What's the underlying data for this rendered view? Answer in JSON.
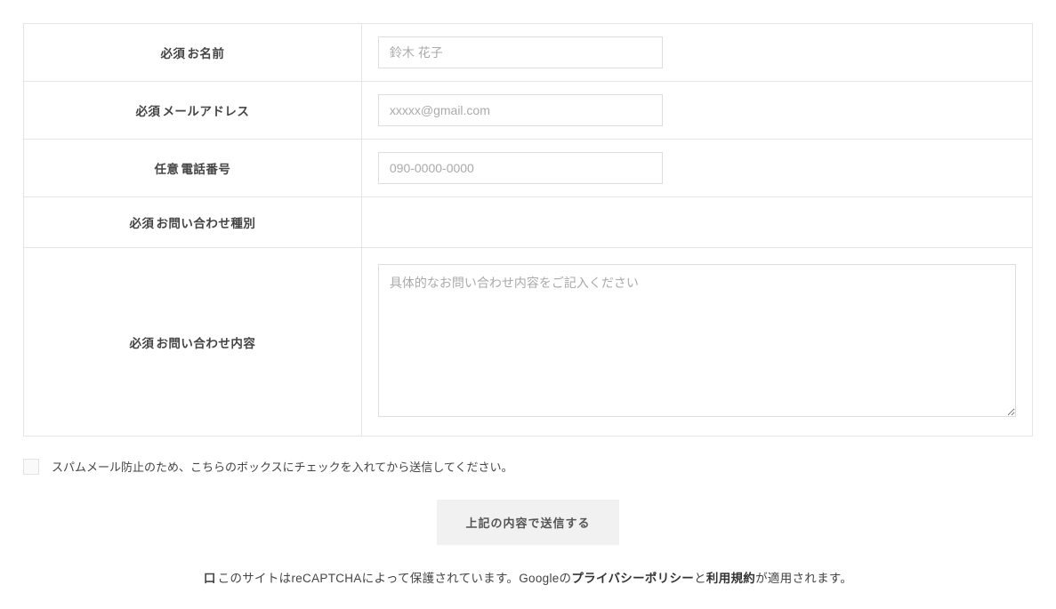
{
  "form": {
    "rows": [
      {
        "badge": "必須",
        "label": "お名前",
        "placeholder": "鈴木 花子"
      },
      {
        "badge": "必須",
        "label": "メールアドレス",
        "placeholder": "xxxxx@gmail.com"
      },
      {
        "badge": "任意",
        "label": "電話番号",
        "placeholder": "090-0000-0000"
      },
      {
        "badge": "必須",
        "label": "お問い合わせ種別"
      },
      {
        "badge": "必須",
        "label": "お問い合わせ内容",
        "placeholder": "具体的なお問い合わせ内容をご記入ください"
      }
    ]
  },
  "spam": {
    "label": "スパムメール防止のため、こちらのボックスにチェックを入れてから送信してください。"
  },
  "submit": {
    "label": "上記の内容で送信する"
  },
  "recaptcha": {
    "prefix_symbol": "口",
    "text1": "このサイトはreCAPTCHAによって保護されています。Googleの",
    "privacy": "プライバシーポリシー",
    "and": "と",
    "terms": "利用規約",
    "text2": "が適用されます。"
  }
}
